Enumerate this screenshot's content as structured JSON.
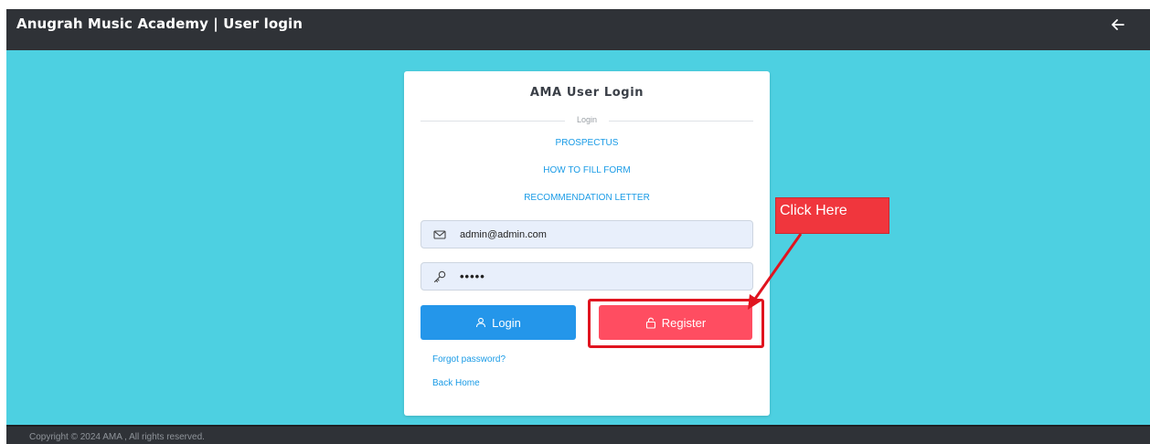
{
  "header": {
    "title": "Anugrah Music Academy | User login",
    "back_icon": "arrow-left-icon"
  },
  "card": {
    "title": "AMA User Login",
    "divider_label": "Login",
    "links": [
      {
        "label": "PROSPECTUS"
      },
      {
        "label": "HOW TO FILL FORM"
      },
      {
        "label": "RECOMMENDATION LETTER"
      }
    ],
    "email": {
      "value": "admin@admin.com",
      "icon": "envelope-icon"
    },
    "password": {
      "value": "•••••",
      "icon": "key-icon"
    },
    "login_button": {
      "label": "Login",
      "icon": "user-icon"
    },
    "register_button": {
      "label": "Register",
      "icon": "lock-icon"
    },
    "forgot_password": "Forgot password?",
    "back_home": "Back Home"
  },
  "annotation": {
    "callout_text": "Click Here",
    "color": "#e0141f"
  },
  "footer": {
    "copyright": "Copyright © 2024 AMA , All rights reserved."
  },
  "colors": {
    "header_bg": "#2f3237",
    "main_bg": "#4dd0e1",
    "login_button": "#2496ea",
    "register_button": "#ff4d61",
    "link": "#1a9be6"
  }
}
